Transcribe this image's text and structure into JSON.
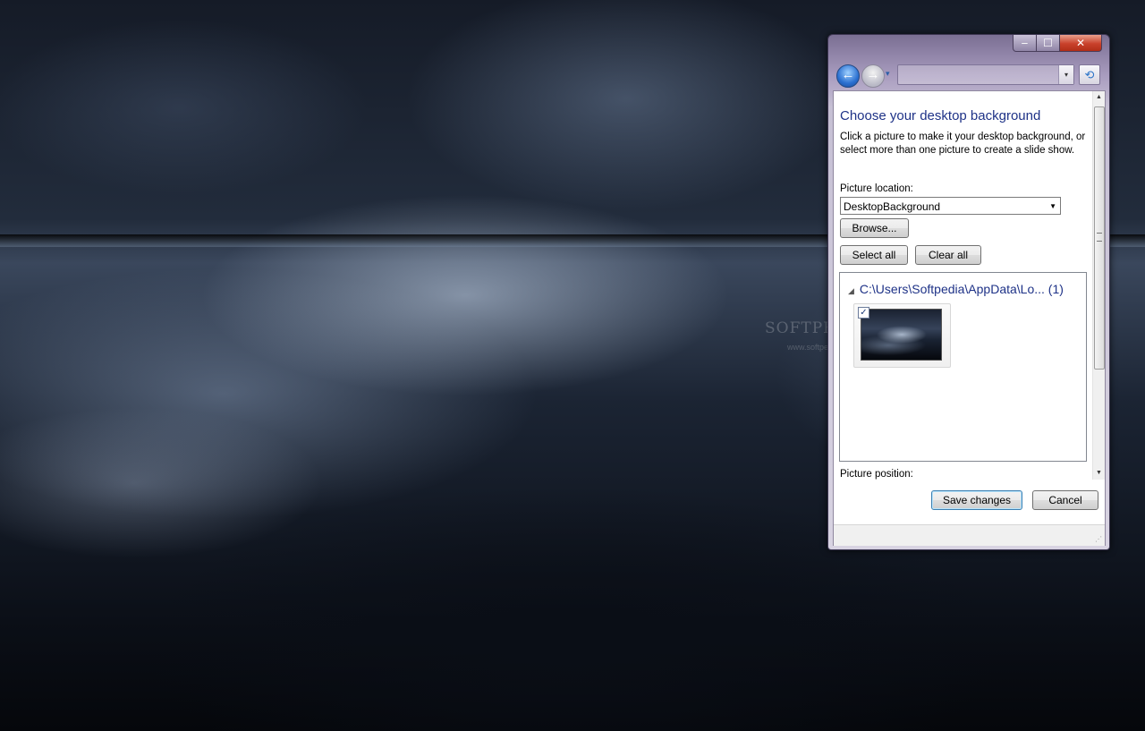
{
  "desktop": {
    "watermark": "SOFTPEDIA",
    "watermark_url": "www.softpedia.com"
  },
  "window": {
    "caption_buttons": {
      "minimize": "‒",
      "maximize": "☐",
      "close": "✕"
    },
    "nav": {
      "back_icon": "←",
      "forward_icon": "→",
      "dropdown_icon": "▾",
      "address_value": "",
      "address_drop_icon": "▾",
      "refresh_icon": "⟲"
    }
  },
  "page": {
    "title": "Choose your desktop background",
    "intro": "Click a picture to make it your desktop background, or select more than one picture to create a slide show.",
    "location_label": "Picture location:",
    "location_value": "DesktopBackground",
    "location_arrow": "▼",
    "browse_label": "Browse...",
    "select_all_label": "Select all",
    "clear_all_label": "Clear all",
    "group": {
      "arrow": "◢",
      "path": "C:\\Users\\Softpedia\\AppData\\Lo... (1)"
    },
    "tile": {
      "checked": true,
      "check_mark": "✓"
    },
    "position_label": "Picture position:"
  },
  "scrollbar": {
    "up": "▲",
    "down": "▼"
  },
  "footer": {
    "save_label": "Save changes",
    "cancel_label": "Cancel",
    "grip": "⋰"
  }
}
